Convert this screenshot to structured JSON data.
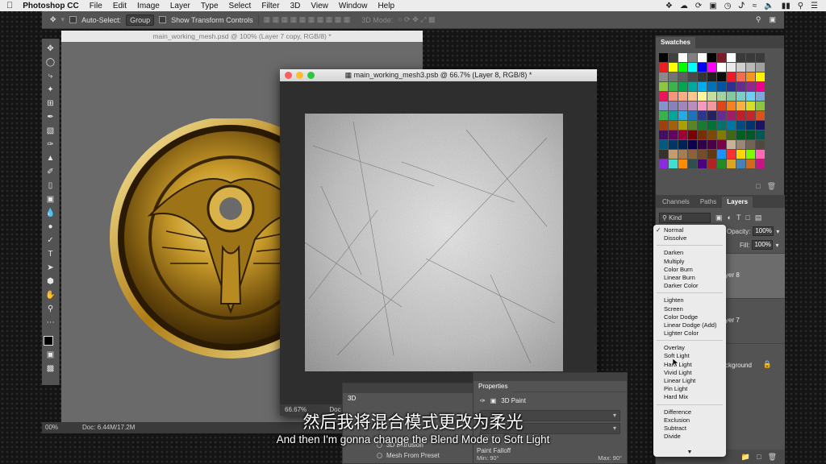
{
  "menubar": {
    "app_name": "Photoshop CC",
    "items": [
      "File",
      "Edit",
      "Image",
      "Layer",
      "Type",
      "Select",
      "Filter",
      "3D",
      "View",
      "Window",
      "Help"
    ]
  },
  "options_bar": {
    "auto_select_label": "Auto-Select:",
    "auto_select_value": "Group",
    "show_transform_label": "Show Transform Controls",
    "mode_3d_label": "3D Mode:"
  },
  "doc_back": {
    "title": "main_working_mesh.psd @ 100% (Layer 7 copy, RGB/8) *",
    "zoom": "00%",
    "doc_size": "Doc: 6.44M/17.2M"
  },
  "doc_front": {
    "title": "main_working_mesh3.psb @ 66.7% (Layer 8, RGB/8) *",
    "zoom": "66.67%",
    "doc_size": "Doc"
  },
  "panel_3d": {
    "tab": "3D",
    "rows": [
      "3D Extrusion",
      "Mesh From Preset"
    ]
  },
  "properties": {
    "tab": "Properties",
    "mode": "3D Paint",
    "falloff": "Paint Falloff",
    "min_label": "Min:",
    "min_value": "90°",
    "max_label": "Max:",
    "max_value": "90°"
  },
  "swatches": {
    "tab": "Swatches",
    "colors": [
      "#000000",
      "#404040",
      "#ffffff",
      "#808080",
      "#ffffff",
      "#000000",
      "#7a1b25",
      "#ffffff",
      "#3a3a3a",
      "#3a3a3a",
      "#3a3a3a",
      "#ee1d24",
      "#ffff00",
      "#00ff00",
      "#00ffff",
      "#0000ff",
      "#ff00ff",
      "#ffffff",
      "#eaeaea",
      "#d0d0d0",
      "#b8b8b8",
      "#a0a0a0",
      "#8a8a8a",
      "#747474",
      "#5e5e5e",
      "#484848",
      "#343434",
      "#202020",
      "#0c0c0c",
      "#ed1c24",
      "#f26c4f",
      "#f7941d",
      "#fff200",
      "#8dc63f",
      "#39b54a",
      "#00a651",
      "#00a99d",
      "#00aeef",
      "#0072bc",
      "#0054a6",
      "#2e3192",
      "#662d91",
      "#92278f",
      "#ec008c",
      "#ed145b",
      "#f69679",
      "#f9ad81",
      "#fdc68a",
      "#fff79a",
      "#c4df9b",
      "#a3d39c",
      "#82ca9d",
      "#7bcdc8",
      "#6dcff6",
      "#7da7d9",
      "#8493ca",
      "#8781bd",
      "#a186be",
      "#bd8cbf",
      "#f49ac1",
      "#f5989d",
      "#e0451b",
      "#f58220",
      "#fbaf3f",
      "#d7df23",
      "#8cc63e",
      "#37b34a",
      "#00a79d",
      "#27aae1",
      "#1c75bc",
      "#2b388f",
      "#262262",
      "#662d91",
      "#9e1f63",
      "#be1e2d",
      "#c1272d",
      "#d9531e",
      "#a0410d",
      "#a36209",
      "#aba000",
      "#598527",
      "#1a7b30",
      "#007236",
      "#00746b",
      "#0076a3",
      "#004b80",
      "#003471",
      "#1b1464",
      "#440e62",
      "#630460",
      "#9e0039",
      "#790000",
      "#7b2e00",
      "#7d4900",
      "#827b00",
      "#406618",
      "#005e20",
      "#005826",
      "#005952",
      "#005b7f",
      "#003663",
      "#002157",
      "#0d004c",
      "#32004b",
      "#4b0049",
      "#7b0046",
      "#c7b299",
      "#998675",
      "#736357",
      "#534741",
      "#37302b",
      "#c69c6d",
      "#a67c52",
      "#8c6239",
      "#754c24",
      "#603913",
      "#1e90ff",
      "#ff3030",
      "#ffd700",
      "#7cfc00",
      "#ff69b4",
      "#8a2be2",
      "#40e0d0",
      "#ff8c00",
      "#2f4f4f",
      "#4b0082",
      "#b22222",
      "#228b22",
      "#daa520",
      "#4682b4",
      "#d2691e",
      "#c71585"
    ]
  },
  "layers_panel": {
    "tabs": [
      "Channels",
      "Paths",
      "Layers"
    ],
    "kind_label": "Kind",
    "opacity_label": "Opacity:",
    "opacity_value": "100%",
    "fill_label": "Fill:",
    "fill_value": "100%",
    "layers": [
      "yer 8",
      "yer 7",
      "ckground"
    ]
  },
  "blend_menu": {
    "groups": [
      [
        "Normal",
        "Dissolve"
      ],
      [
        "Darken",
        "Multiply",
        "Color Burn",
        "Linear Burn",
        "Darker Color"
      ],
      [
        "Lighten",
        "Screen",
        "Color Dodge",
        "Linear Dodge (Add)",
        "Lighter Color"
      ],
      [
        "Overlay",
        "Soft Light",
        "Hard Light",
        "Vivid Light",
        "Linear Light",
        "Pin Light",
        "Hard Mix"
      ],
      [
        "Difference",
        "Exclusion",
        "Subtract",
        "Divide"
      ]
    ],
    "selected": "Normal"
  },
  "subtitles": {
    "chinese": "然后我将混合模式更改为柔光",
    "english": "And then I'm gonna change the Blend Mode to Soft Light"
  }
}
